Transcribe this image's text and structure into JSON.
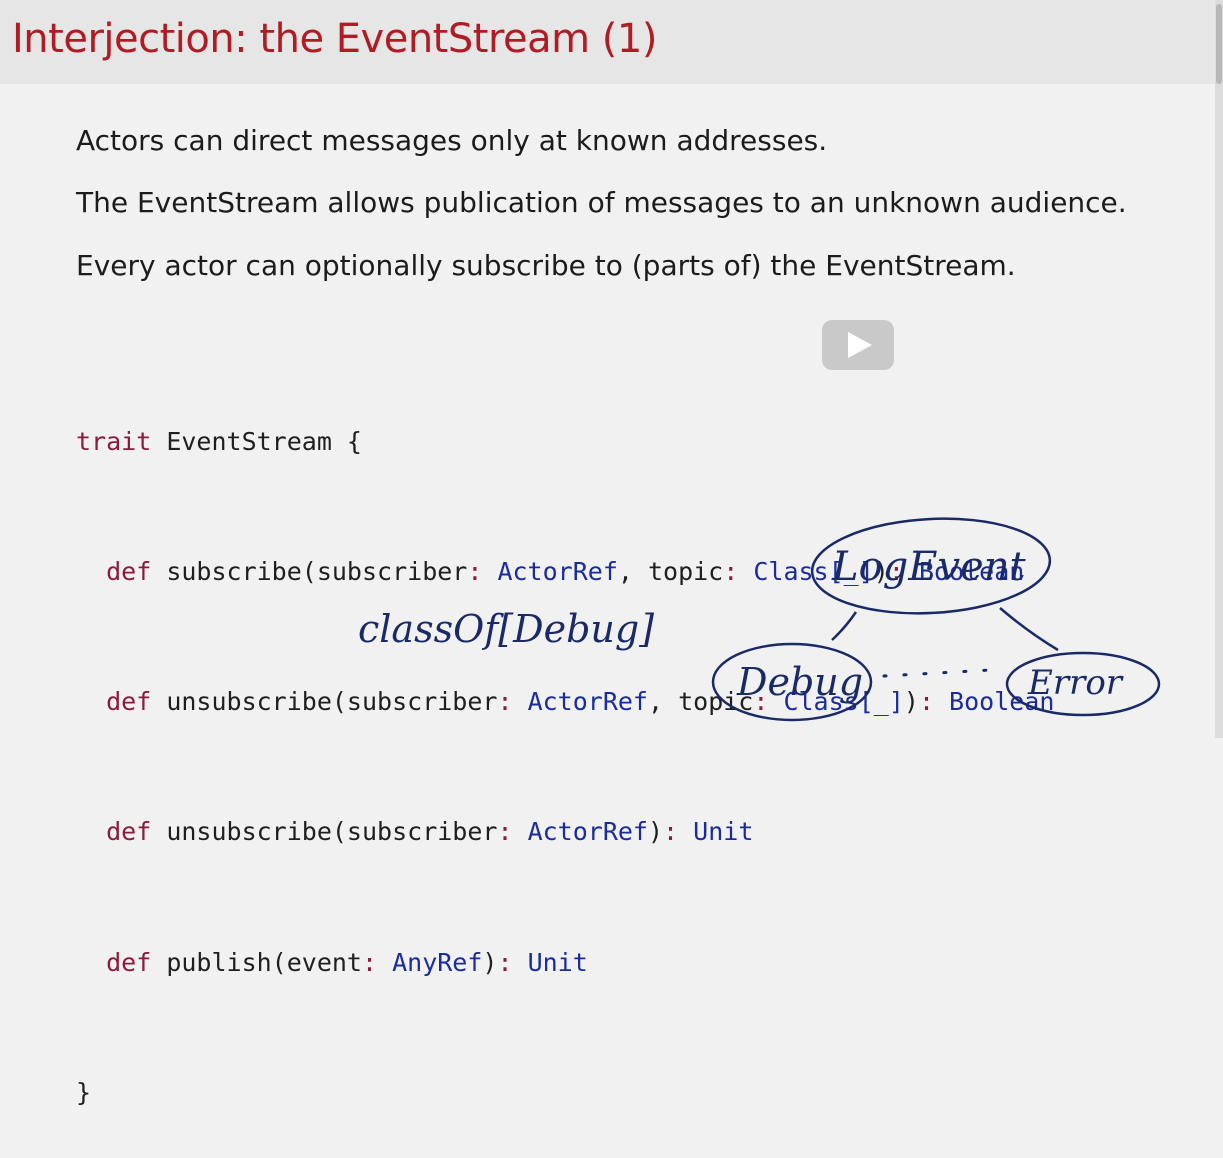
{
  "slide": {
    "title": "Interjection: the EventStream (1)",
    "paragraphs": [
      "Actors can direct messages only at known addresses.",
      "The EventStream allows publication of messages to an unknown audience.",
      "Every actor can optionally subscribe to (parts of) the EventStream."
    ]
  },
  "code": {
    "line0": {
      "kw": "trait",
      "rest": " EventStream {"
    },
    "line1": {
      "indent": "  ",
      "kw": "def",
      "p1": " subscribe(subscriber",
      "c1": ":",
      "t1": " ActorRef",
      "p2": ", topic",
      "c2": ":",
      "t2": " Class[_]",
      "p3": ")",
      "c3": ":",
      "t3": " Boolean"
    },
    "line2": {
      "indent": "  ",
      "kw": "def",
      "p1": " unsubscribe(subscriber",
      "c1": ":",
      "t1": " ActorRef",
      "p2": ", topic",
      "c2": ":",
      "t2": " Class[_]",
      "p3": ")",
      "c3": ":",
      "t3": " Boolean"
    },
    "line3": {
      "indent": "  ",
      "kw": "def",
      "p1": " unsubscribe(subscriber",
      "c1": ":",
      "t1": " ActorRef",
      "p2": ")",
      "c2": ":",
      "t2": " Unit"
    },
    "line4": {
      "indent": "  ",
      "kw": "def",
      "p1": " publish(event",
      "c1": ":",
      "t1": " AnyRef",
      "p2": ")",
      "c2": ":",
      "t2": " Unit"
    },
    "line5": {
      "text": "}"
    }
  },
  "annotations": {
    "class_of": "classOf[Debug]",
    "log_event": "LogEvent",
    "debug": "Debug",
    "error": "Error"
  },
  "video": {
    "play_icon": "play-icon"
  },
  "colors": {
    "title": "#b01c24",
    "keyword": "#8a1b3c",
    "type": "#1a2b9c",
    "ink": "#1a2a66"
  }
}
